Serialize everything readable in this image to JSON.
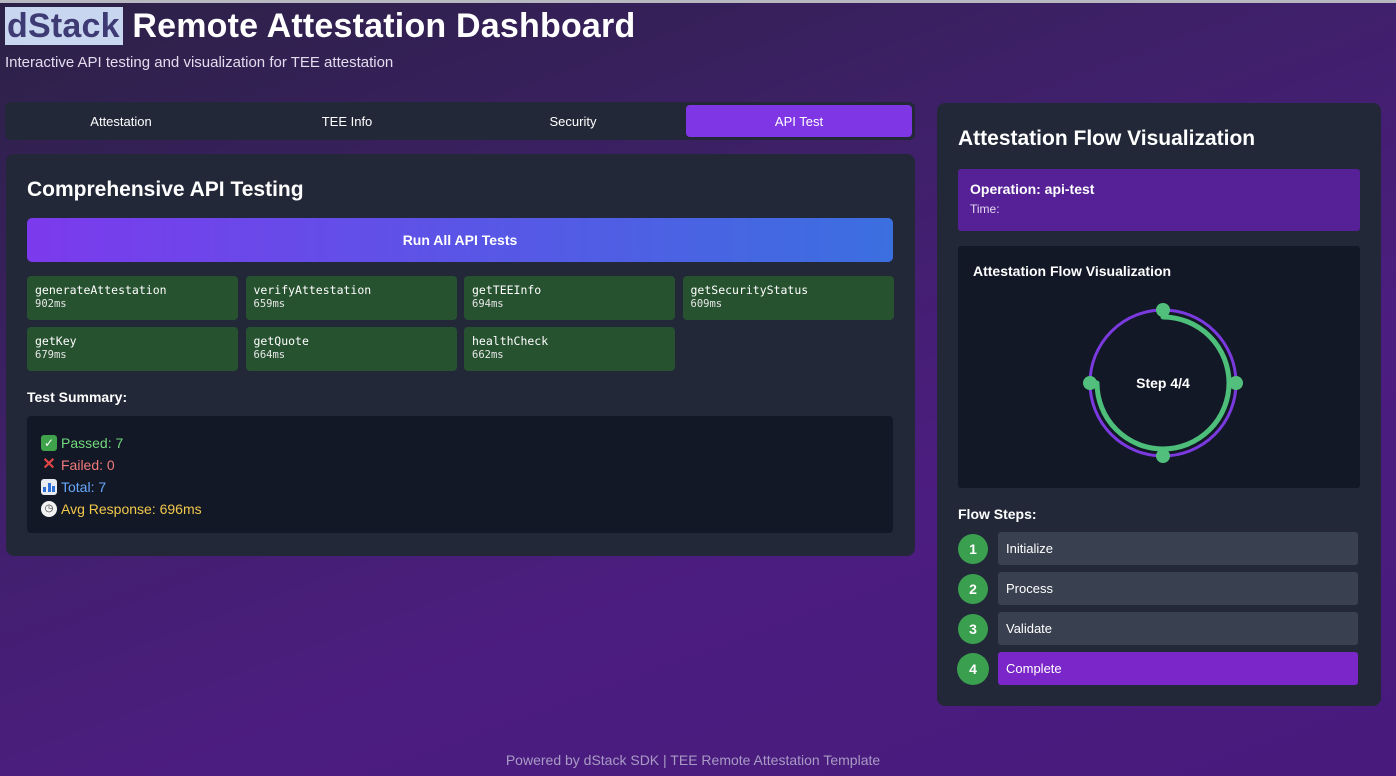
{
  "header": {
    "brand": "dStack",
    "title_rest": "Remote Attestation Dashboard",
    "subtitle": "Interactive API testing and visualization for TEE attestation"
  },
  "tabs": [
    {
      "label": "Attestation",
      "active": false
    },
    {
      "label": "TEE Info",
      "active": false
    },
    {
      "label": "Security",
      "active": false
    },
    {
      "label": "API Test",
      "active": true
    }
  ],
  "api_testing": {
    "title": "Comprehensive API Testing",
    "run_button": "Run All API Tests",
    "tests": [
      {
        "name": "generateAttestation",
        "time": "902ms"
      },
      {
        "name": "verifyAttestation",
        "time": "659ms"
      },
      {
        "name": "getTEEInfo",
        "time": "694ms"
      },
      {
        "name": "getSecurityStatus",
        "time": "609ms"
      },
      {
        "name": "getKey",
        "time": "679ms"
      },
      {
        "name": "getQuote",
        "time": "664ms"
      },
      {
        "name": "healthCheck",
        "time": "662ms"
      }
    ],
    "summary_label": "Test Summary:",
    "summary": {
      "passed": "Passed: 7",
      "failed": "Failed: 0",
      "total": "Total: 7",
      "avg": "Avg Response: 696ms"
    }
  },
  "flow": {
    "title": "Attestation Flow Visualization",
    "operation": "Operation: api-test",
    "time": "Time:",
    "viz_title": "Attestation Flow Visualization",
    "step_text": "Step 4/4",
    "progress": 0.75,
    "steps_label": "Flow Steps:",
    "steps": [
      {
        "num": "1",
        "label": "Initialize"
      },
      {
        "num": "2",
        "label": "Process"
      },
      {
        "num": "3",
        "label": "Validate"
      },
      {
        "num": "4",
        "label": "Complete"
      }
    ],
    "current_step": 4,
    "colors": {
      "ring": "#7b3ae0",
      "progress": "#4dbf7a",
      "node": "#52c07c"
    }
  },
  "footer": "Powered by dStack SDK | TEE Remote Attestation Template"
}
